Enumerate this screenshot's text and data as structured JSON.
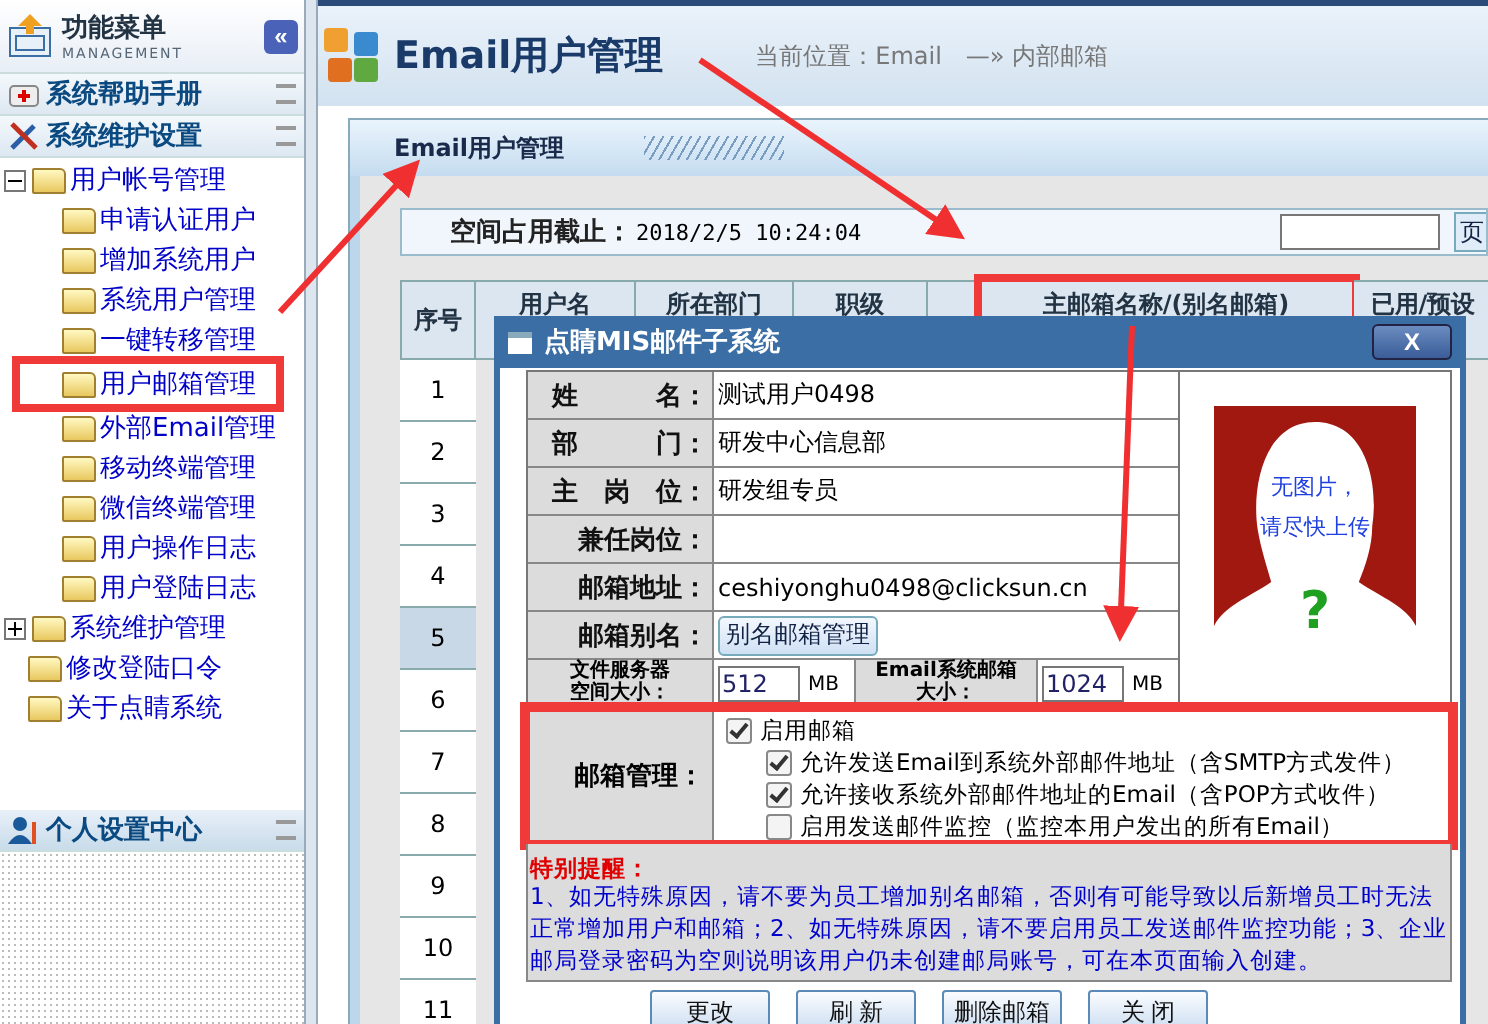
{
  "sidebar": {
    "title": "功能菜单",
    "subtitle": "MANAGEMENT",
    "collapse_button": "«",
    "sections": [
      {
        "label": "系统帮助手册",
        "kind": "help"
      },
      {
        "label": "系统维护设置",
        "kind": "tools"
      }
    ],
    "tree": [
      {
        "label": "用户帐号管理",
        "expanded": true,
        "children": [
          {
            "label": "申请认证用户",
            "callout": false
          },
          {
            "label": "增加系统用户",
            "callout": false
          },
          {
            "label": "系统用户管理",
            "callout": false
          },
          {
            "label": "一键转移管理",
            "callout": false
          },
          {
            "label": "用户邮箱管理",
            "callout": true
          },
          {
            "label": "外部Email管理",
            "callout": false
          },
          {
            "label": "移动终端管理",
            "callout": false
          },
          {
            "label": "微信终端管理",
            "callout": false
          },
          {
            "label": "用户操作日志",
            "callout": false
          },
          {
            "label": "用户登陆日志",
            "callout": false
          }
        ]
      },
      {
        "label": "系统维护管理",
        "expanded": false
      },
      {
        "label": "修改登陆口令"
      },
      {
        "label": "关于点睛系统"
      }
    ],
    "bottom_section": {
      "label": "个人设置中心"
    }
  },
  "header": {
    "title": "Email用户管理",
    "breadcrumb": "当前位置：Email　—» 内部邮箱"
  },
  "panel": {
    "title": "Email用户管理",
    "space_label": "空间占用截止：",
    "space_time": "2018/2/5 10:24:04",
    "page_button": "页"
  },
  "table": {
    "columns": [
      {
        "label": "序号",
        "callout": false
      },
      {
        "label": "用户名",
        "callout": false
      },
      {
        "label": "所在部门",
        "callout": false
      },
      {
        "label": "职级",
        "callout": false
      },
      {
        "callout": false
      },
      {
        "label": "主邮箱名称/(别名邮箱)",
        "callout": true
      },
      {
        "label": "已用/预设",
        "callout": false
      }
    ],
    "rows": [
      {
        "number": "1",
        "selected": false
      },
      {
        "number": "2",
        "selected": false
      },
      {
        "number": "3",
        "selected": false
      },
      {
        "number": "4",
        "selected": false
      },
      {
        "number": "5",
        "selected": true
      },
      {
        "number": "6",
        "selected": false
      },
      {
        "number": "7",
        "selected": false
      },
      {
        "number": "8",
        "selected": false
      },
      {
        "number": "9",
        "selected": false
      },
      {
        "number": "10",
        "selected": false
      },
      {
        "number": "11",
        "selected": false
      }
    ]
  },
  "dialog": {
    "title": "点睛MIS邮件子系统",
    "close": "X",
    "fields": [
      {
        "kind": "text",
        "label": "姓　　　名：",
        "value": "测试用户0498"
      },
      {
        "kind": "text",
        "label": "部　　　门：",
        "value": "研发中心信息部"
      },
      {
        "kind": "text",
        "label": "主　岗　位：",
        "value": "研发组专员"
      },
      {
        "kind": "text",
        "label": "兼任岗位："
      },
      {
        "kind": "text",
        "label": "邮箱地址：",
        "value": "ceshiyonghu0498@clicksun.cn"
      },
      {
        "kind": "button",
        "label": "邮箱别名：",
        "value": "别名邮箱管理"
      }
    ],
    "quota": [
      {
        "label": "文件服务器空间大小：",
        "value": "512",
        "unit": "MB"
      },
      {
        "label": "Email系统邮箱大小：",
        "value": "1024",
        "unit": "MB"
      }
    ],
    "photo": {
      "line1": "无图片，",
      "line2": "请尽快上传",
      "mark": "?"
    },
    "mail_management": {
      "label": "邮箱管理：",
      "callout": true,
      "options": [
        {
          "label": "启用邮箱",
          "checked": true,
          "children": [
            {
              "label": "允许发送Email到系统外部邮件地址（含SMTP方式发件）",
              "checked": true
            },
            {
              "label": "允许接收系统外部邮件地址的Email（含POP方式收件）",
              "checked": true
            },
            {
              "label": "启用发送邮件监控（监控本用户发出的所有Email）",
              "checked": false
            }
          ]
        }
      ]
    },
    "notice": {
      "title": "特别提醒：",
      "text": "1、如无特殊原因，请不要为员工增加别名邮箱，否则有可能导致以后新增员工时无法正常增加用户和邮箱；2、如无特殊原因，请不要启用员工发送邮件监控功能；3、企业邮局登录密码为空则说明该用户仍未创建邮局账号，可在本页面输入创建。"
    },
    "buttons": [
      "更改",
      "刷 新",
      "删除邮箱",
      "关 闭"
    ]
  }
}
